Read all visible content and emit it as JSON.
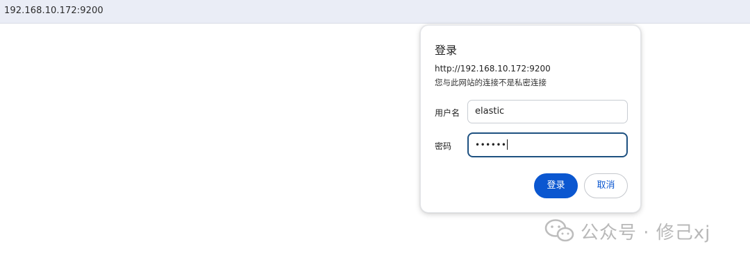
{
  "browser": {
    "url": "192.168.10.172:9200"
  },
  "auth_dialog": {
    "title": "登录",
    "origin": "http://192.168.10.172:9200",
    "warning": "您与此网站的连接不是私密连接",
    "username_label": "用户名",
    "username_value": "elastic",
    "password_label": "密码",
    "password_masked": "••••••",
    "login_button": "登录",
    "cancel_button": "取消"
  },
  "watermark": {
    "text": "公众号 · 修己xj",
    "icon": "wechat-icon"
  },
  "colors": {
    "primary": "#0b57d0",
    "focus_border": "#1d5080",
    "address_bar": "#eaedf6"
  }
}
